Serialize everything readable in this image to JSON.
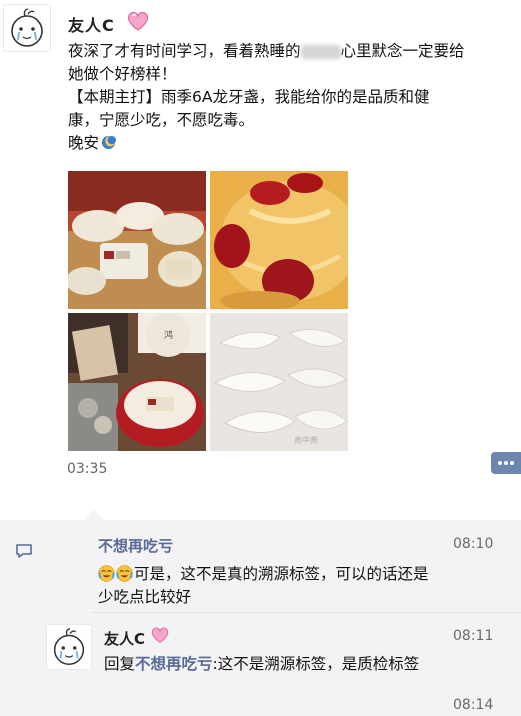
{
  "post": {
    "author": "友人C",
    "text_line1_a": "夜深了才有时间学习，看着熟睡的",
    "text_line1_b": "心里默念一定要给",
    "text_line2": "她做个好榜样！",
    "text_line3": "【本期主打】雨季6A龙牙盏，我能给你的是品质和健",
    "text_line4": "康，宁愿少吃，不愿吃毒。",
    "text_line5": "晚安",
    "time": "03:35",
    "photo_labels": [
      "鸿",
      "燕中燕"
    ]
  },
  "comments": [
    {
      "name": "不想再吃亏",
      "time": "08:10",
      "text_line1": "可是，这不是真的溯源标签，可以的话还是",
      "text_line2": "少吃点比较好"
    },
    {
      "name": "友人C",
      "time": "08:11",
      "reply_prefix": "回复",
      "reply_to": "不想再吃亏",
      "text": ":这不是溯源标签，是质检标签"
    },
    {
      "time": "08:14"
    }
  ],
  "colors": {
    "link": "#576b95",
    "comment_bg": "#f3f3f5",
    "more_button": "#6d86ad"
  },
  "icons": {
    "heart": "pink-heart-icon",
    "moon": "moon-emoji-icon",
    "cry": "crying-laugh-emoji-icon",
    "comment": "comment-icon",
    "more": "more-dots-icon"
  }
}
